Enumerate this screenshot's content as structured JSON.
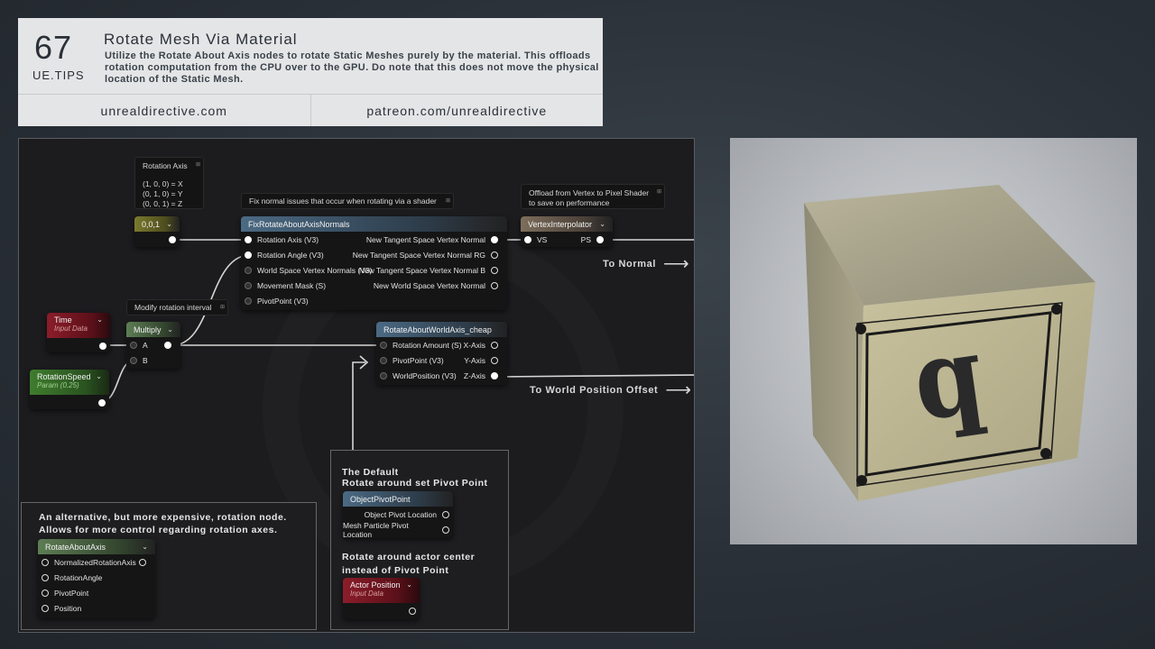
{
  "header": {
    "tip_number": "67",
    "tip_tag": "UE.TIPS",
    "title": "Rotate Mesh Via Material",
    "description": "Utilize the Rotate About Axis nodes to rotate Static Meshes purely by the material. This offloads rotation computation from the CPU over to the GPU. Do note that this does not move the physical location of the Static Mesh.",
    "link_left": "unrealdirective.com",
    "link_right": "patreon.com/unrealdirective"
  },
  "graph": {
    "comment_rotation_axis": {
      "title": "Rotation Axis",
      "lines": [
        "(1, 0, 0) = X",
        "(0, 1, 0) = Y",
        "(0, 0, 1) = Z"
      ]
    },
    "constant_node": {
      "label": "0,0,1"
    },
    "comment_fix_normals": "Fix normal issues that occur when rotating via a shader",
    "comment_offload": "Offload from Vertex to Pixel Shader to save on performance",
    "comment_modify": "Modify rotation interval",
    "fix_node": {
      "title": "FixRotateAboutAxisNormals",
      "inputs": [
        "Rotation Axis (V3)",
        "Rotation Angle (V3)",
        "World Space Vertex Normals (V3)",
        "Movement Mask (S)",
        "PivotPoint (V3)"
      ],
      "outputs": [
        "New Tangent Space Vertex Normal",
        "New Tangent Space Vertex Normal RG",
        "New Tangent Space Vertex Normal B",
        "New World Space Vertex Normal"
      ]
    },
    "vertex_node": {
      "title": "VertexInterpolator",
      "in": "VS",
      "out": "PS"
    },
    "time_node": {
      "title": "Time",
      "sub": "Input Data"
    },
    "speed_node": {
      "title": "RotationSpeed",
      "sub": "Param (0.25)"
    },
    "multiply_node": {
      "title": "Multiply",
      "a": "A",
      "b": "B"
    },
    "rotate_cheap": {
      "title": "RotateAboutWorldAxis_cheap",
      "inputs": [
        "Rotation Amount (S)",
        "PivotPoint (V3)",
        "WorldPosition (V3)"
      ],
      "outputs": [
        "X-Axis",
        "Y-Axis",
        "Z-Axis"
      ]
    },
    "to_normal": "To Normal",
    "to_wpo": "To World Position Offset",
    "alt_box": {
      "text": "An alternative, but more expensive, rotation node. Allows for more control regarding rotation axes.",
      "node_title": "RotateAboutAxis",
      "inputs": [
        "NormalizedRotationAxis",
        "RotationAngle",
        "PivotPoint",
        "Position"
      ]
    },
    "default_box": {
      "title_line1": "The Default",
      "title_line2": "Rotate around set Pivot Point",
      "pivot_node_title": "ObjectPivotPoint",
      "pivot_outputs": [
        "Object Pivot Location",
        "Mesh Particle Pivot Location"
      ],
      "actor_text_line1": "Rotate around actor center",
      "actor_text_line2": "instead of Pivot Point",
      "actor_node_title": "Actor Position",
      "actor_node_sub": "Input Data"
    }
  },
  "preview": {
    "cube_letter": "q"
  }
}
